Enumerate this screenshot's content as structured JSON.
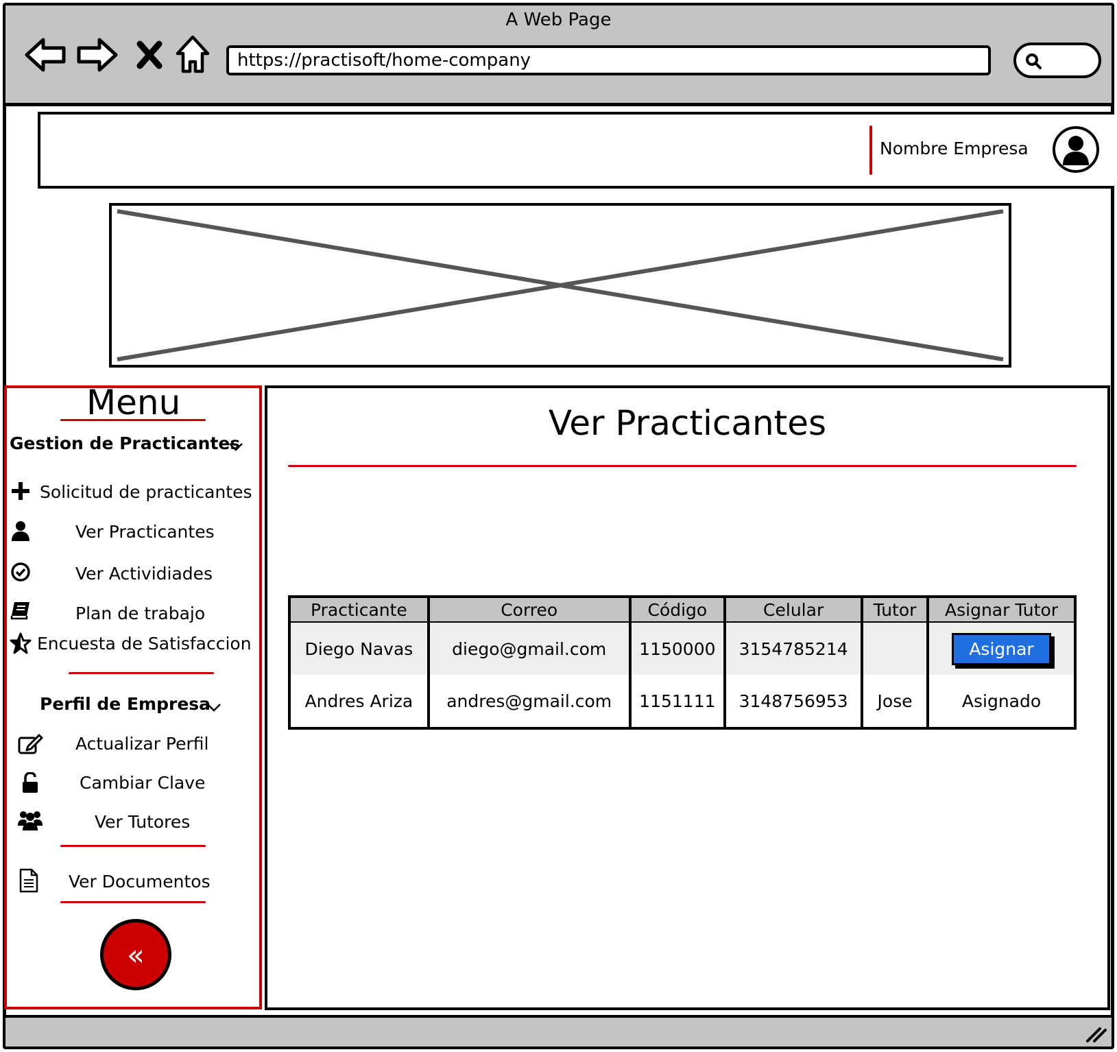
{
  "window": {
    "title": "A Web Page"
  },
  "browser": {
    "url": "https://practisoft/home-company"
  },
  "header": {
    "company_name": "Nombre Empresa"
  },
  "sidebar": {
    "title": "Menu",
    "section1": {
      "title": "Gestion de Practicantes"
    },
    "items1": [
      {
        "label": "Solicitud de practicantes",
        "icon": "plus-icon"
      },
      {
        "label": "Ver Practicantes",
        "icon": "user-icon"
      },
      {
        "label": "Ver Actividiades",
        "icon": "check-circle-icon"
      },
      {
        "label": "Plan de trabajo",
        "icon": "book-icon"
      },
      {
        "label": "Encuesta de Satisfaccion",
        "icon": "star-icon"
      }
    ],
    "section2": {
      "title": "Perfil de Empresa"
    },
    "items2": [
      {
        "label": "Actualizar Perfil",
        "icon": "edit-icon"
      },
      {
        "label": "Cambiar Clave",
        "icon": "unlock-icon"
      },
      {
        "label": "Ver Tutores",
        "icon": "users-icon"
      }
    ],
    "documents": {
      "label": "Ver Documentos",
      "icon": "document-icon"
    },
    "collapse_label": "«"
  },
  "main": {
    "title": "Ver Practicantes",
    "table": {
      "headers": [
        "Practicante",
        "Correo",
        "Código",
        "Celular",
        "Tutor",
        "Asignar Tutor"
      ],
      "rows": [
        {
          "practicante": "Diego Navas",
          "correo": "diego@gmail.com",
          "codigo": "1150000",
          "celular": "3154785214",
          "tutor": "",
          "action": "Asignar"
        },
        {
          "practicante": "Andres Ariza",
          "correo": "andres@gmail.com",
          "codigo": "1151111",
          "celular": "3148756953",
          "tutor": "Jose",
          "action": "Asignado"
        }
      ]
    }
  },
  "colors": {
    "accent_red": "#cc0000",
    "button_blue": "#1f6fe0",
    "chrome_gray": "#c4c4c4"
  }
}
